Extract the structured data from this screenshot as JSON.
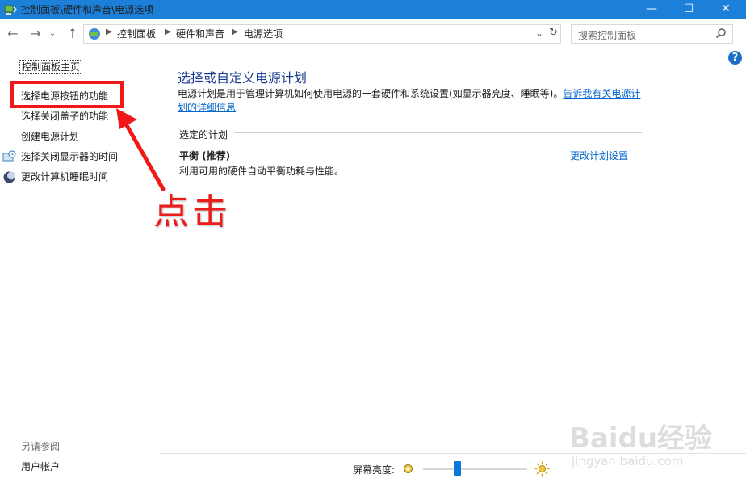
{
  "window": {
    "title": "控制面板\\硬件和声音\\电源选项",
    "minimize": "—",
    "maximize": "☐",
    "close": "✕"
  },
  "address": {
    "crumbs": [
      "控制面板",
      "硬件和声音",
      "电源选项"
    ],
    "search_placeholder": "搜索控制面板"
  },
  "nav": {
    "home": "控制面板主页",
    "items": [
      "选择电源按钮的功能",
      "选择关闭盖子的功能",
      "创建电源计划",
      "选择关闭显示器的时间",
      "更改计算机睡眠时间"
    ]
  },
  "annotation": {
    "click_label": "点击"
  },
  "main": {
    "title": "选择或自定义电源计划",
    "description": "电源计划是用于管理计算机如何使用电源的一套硬件和系统设置(如显示器亮度、睡眠等)。",
    "description_link": "告诉我有关电源计划的详细信息",
    "section_label": "选定的计划",
    "plan_name": "平衡 (推荐)",
    "plan_description": "利用可用的硬件自动平衡功耗与性能。",
    "plan_link": "更改计划设置"
  },
  "see_also": {
    "heading": "另请参阅",
    "items": [
      "用户帐户"
    ]
  },
  "brightness": {
    "label": "屏幕亮度:",
    "level": 0.33
  },
  "watermark": {
    "logo": "Baidu经验",
    "url": "jingyan.baidu.com"
  },
  "colors": {
    "titlebar": "#1c7fd8",
    "link": "#0066cc",
    "heading": "#1b3d91",
    "annotation": "#ef1919"
  }
}
